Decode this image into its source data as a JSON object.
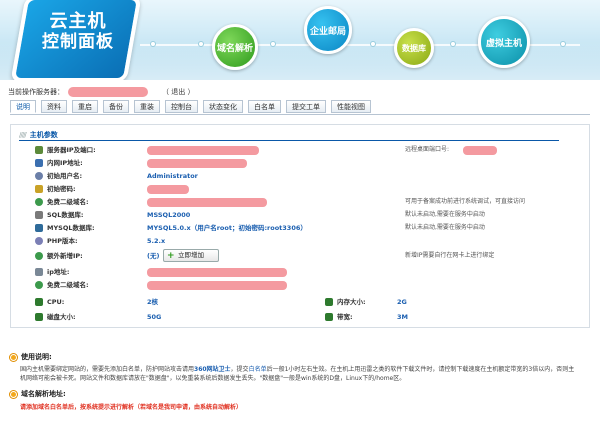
{
  "banner": {
    "logo_line1": "云主机",
    "logo_line2": "控制面板",
    "nav": [
      {
        "label": "域名解析"
      },
      {
        "label": "企业邮局"
      },
      {
        "label": "数据库"
      },
      {
        "label": "虚拟主机"
      }
    ]
  },
  "op": {
    "label": "当前操作服务器：",
    "logout": "（ 退出 ）"
  },
  "tabs": [
    "说明",
    "资料",
    "重启",
    "备份",
    "重装",
    "控制台",
    "状态变化",
    "白名单",
    "提交工单",
    "性能视图"
  ],
  "panel": {
    "title": "主机参数",
    "rows": [
      {
        "label": "服务器IP及端口:",
        "value": "",
        "note": "远程桌面端口号:"
      },
      {
        "label": "内网IP地址:",
        "value": "",
        "note": ""
      },
      {
        "label": "初始用户名:",
        "value": "Administrator",
        "note": ""
      },
      {
        "label": "初始密码:",
        "value": "",
        "note": ""
      },
      {
        "label": "免费二级域名:",
        "value": "",
        "note": "可用于备案成功前进行系统调试，可直接访问"
      },
      {
        "label": "SQL数据库:",
        "value": "MSSQL2000",
        "note": "默认未启动,需要在服务中启动"
      },
      {
        "label": "MYSQL数据库:",
        "value": "MYSQL5.0.x（用户名root；初始密码:root3306）",
        "note": "默认未启动,需要在服务中启动"
      },
      {
        "label": "PHP版本:",
        "value": "5.2.x",
        "note": ""
      },
      {
        "label": "额外新增IP:",
        "value": "(无)",
        "note": "新增IP需要自行在网卡上进行绑定"
      },
      {
        "label": "ip地址:",
        "value": "",
        "note": ""
      },
      {
        "label": "免费二级域名:",
        "value": "",
        "note": ""
      }
    ],
    "add_button": "立即增加",
    "specs": [
      {
        "label": "CPU:",
        "value": "2核",
        "label2": "内存大小:",
        "value2": "2G"
      },
      {
        "label": "磁盘大小:",
        "value": "50G",
        "label2": "带宽:",
        "value2": "3M"
      }
    ]
  },
  "info": {
    "usage_title": "使用说明:",
    "usage_text_1": "国内主机需要绑定网站的，需要先添加白名单，防护网站攻击请用",
    "usage_hl": "360网站卫士",
    "usage_text_2": "，提交",
    "usage_chip": "白名单",
    "usage_text_3": "后一般1小时左右生效。在主机上用迅雷之类的软件下载文件时，请控制下载速度在主机额定带宽的3倍以内，否则主机网络可能会被卡死。网站文件和数据库请放在\"数据盘\"，以免重装系统后数据发生丢失。\"数据盘\"一般是win系统的D盘，Linux下的/home区。",
    "dns_title": "域名解析地址:",
    "dns_note": "请添加域名白名单后，按系统提示进行解析（若域名是我司申请，由系统自动解析）"
  },
  "colors": {
    "accent": "#1b5fb0",
    "redact": "#f49aa0",
    "warn": "#e03020"
  }
}
